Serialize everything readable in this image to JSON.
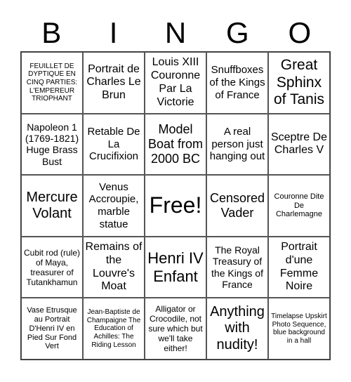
{
  "header": [
    "B",
    "I",
    "N",
    "G",
    "O"
  ],
  "cells": [
    {
      "text": "FEUILLET DE DYPTIQUE EN CINQ PARTIES: L'EMPEREUR TRIOPHANT",
      "size": 10
    },
    {
      "text": "Portrait de Charles Le Brun",
      "size": 16
    },
    {
      "text": "Louis XIII Couronne Par La Victorie",
      "size": 16
    },
    {
      "text": "Snuffboxes of the Kings of France",
      "size": 15
    },
    {
      "text": "Great Sphinx of Tanis",
      "size": 21
    },
    {
      "text": "Napoleon 1 (1769-1821) Huge Brass Bust",
      "size": 14
    },
    {
      "text": "Retable De La Crucifixion",
      "size": 15
    },
    {
      "text": "Model Boat from 2000 BC",
      "size": 18
    },
    {
      "text": "A real person just hanging out",
      "size": 15
    },
    {
      "text": "Sceptre De Charles V",
      "size": 16
    },
    {
      "text": "Mercure Volant",
      "size": 20
    },
    {
      "text": "Venus Accroupie, marble statue",
      "size": 15
    },
    {
      "text": "Free!",
      "size": 32
    },
    {
      "text": "Censored Vader",
      "size": 18
    },
    {
      "text": "Couronne Dite De Charlemagne",
      "size": 11
    },
    {
      "text": "Cubit rod (rule) of Maya, treasurer of Tutankhamun",
      "size": 12
    },
    {
      "text": "Remains of the Louvre's Moat",
      "size": 16
    },
    {
      "text": "Henri IV Enfant",
      "size": 22
    },
    {
      "text": "The Royal Treasury of the Kings of France",
      "size": 14
    },
    {
      "text": "Portrait d'une Femme Noire",
      "size": 16
    },
    {
      "text": "Vase Etrusque au Portrait D'Henri IV en Pied Sur Fond Vert",
      "size": 11
    },
    {
      "text": "Jean-Baptiste de Champaigne The Education of Achilles: The Riding Lesson",
      "size": 10
    },
    {
      "text": "Alligator or Crocodile, not sure which but we'll take either!",
      "size": 12
    },
    {
      "text": "Anything with nudity!",
      "size": 20
    },
    {
      "text": "Timelapse Upskirt Photo Sequence, blue background in a hall",
      "size": 10
    }
  ]
}
